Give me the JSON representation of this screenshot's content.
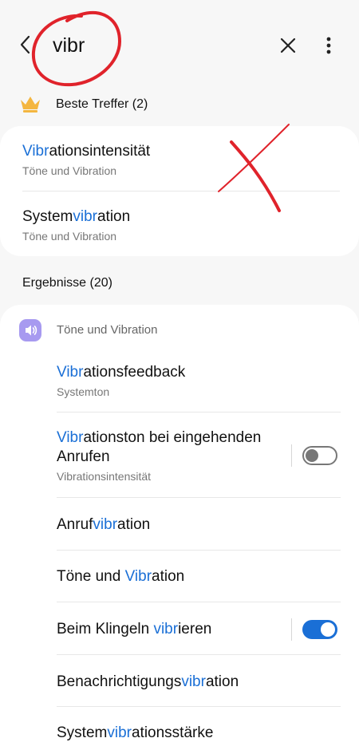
{
  "header": {
    "search_value": "vibr"
  },
  "best_matches": {
    "label": "Beste Treffer (2)",
    "items": [
      {
        "pre": "",
        "hl": "Vibr",
        "post": "ationsintensität",
        "sub": "Töne und Vibration"
      },
      {
        "pre": "System",
        "hl": "vibr",
        "post": "ation",
        "sub": "Töne und Vibration"
      }
    ]
  },
  "results": {
    "label": "Ergebnisse (20)",
    "group_label": "Töne und Vibration",
    "items": [
      {
        "pre": "",
        "hl": "Vibr",
        "post": "ationsfeedback",
        "sub": "Systemton"
      },
      {
        "pre": "",
        "hl": "Vibr",
        "post": "ationston bei eingehenden",
        "line2": "Anrufen",
        "sub": "Vibrationsintensität",
        "toggle": "off"
      },
      {
        "pre": "Anruf",
        "hl": "vibr",
        "post": "ation"
      },
      {
        "pre": "Töne und ",
        "hl": "Vibr",
        "post": "ation"
      },
      {
        "pre": "Beim Klingeln ",
        "hl": "vibr",
        "post": "ieren",
        "toggle": "on"
      },
      {
        "pre": "Benachrichtigungs",
        "hl": "vibr",
        "post": "ation"
      },
      {
        "pre": "System",
        "hl": "vibr",
        "post": "ationsstärke"
      }
    ]
  },
  "colors": {
    "highlight": "#1a6fd6",
    "annotation": "#e0232b",
    "toggle_on": "#1a6fd6"
  },
  "icons": [
    "back-arrow-icon",
    "close-icon",
    "more-vertical-icon",
    "crown-icon",
    "volume-icon"
  ]
}
